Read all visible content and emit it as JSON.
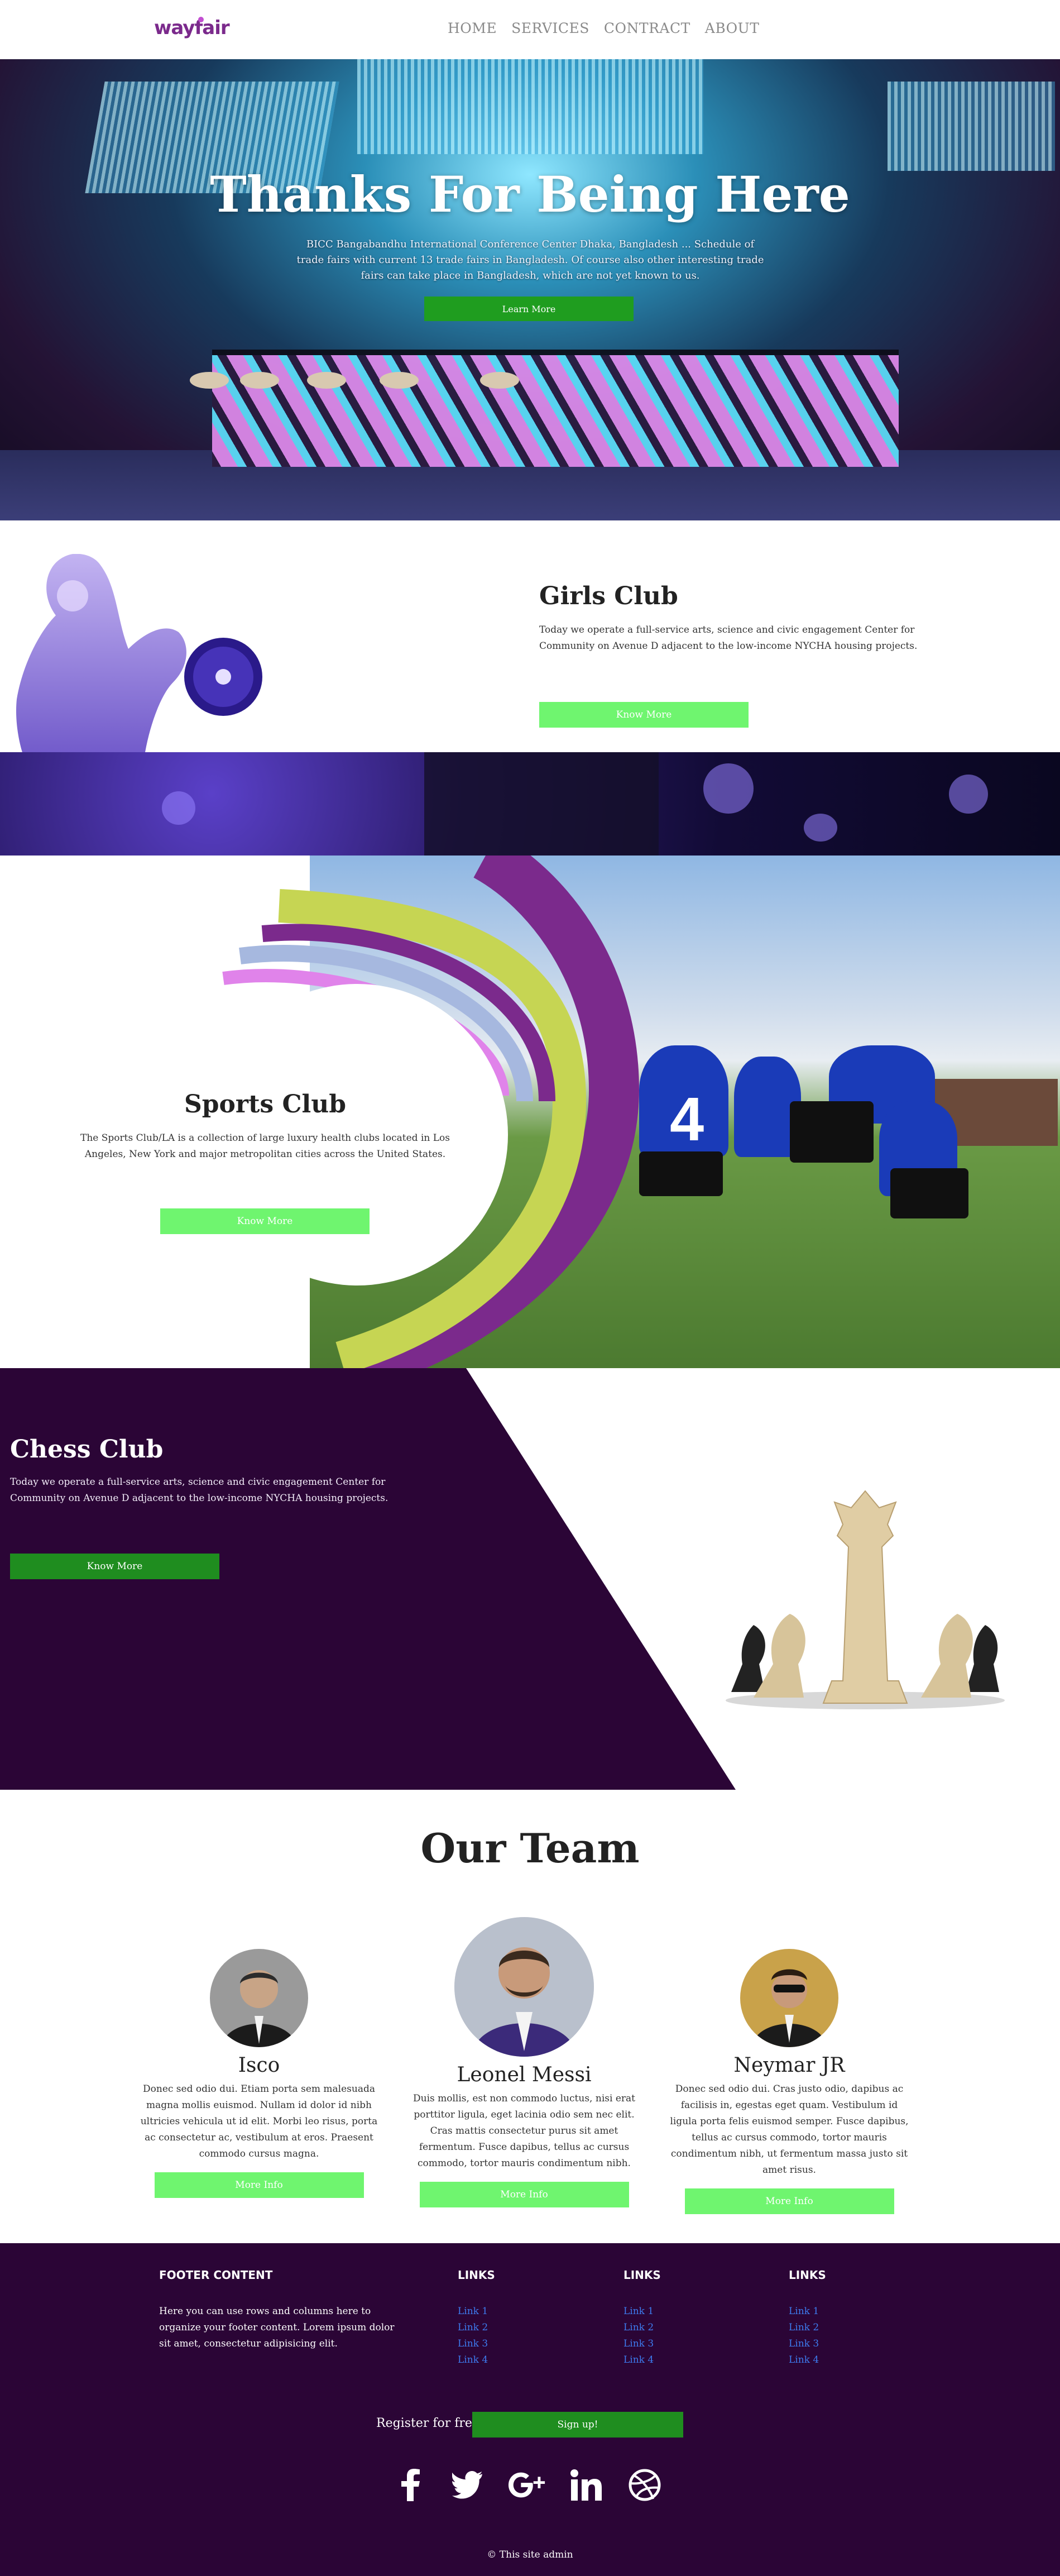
{
  "nav": {
    "logo": "wayfair",
    "links": [
      "HOME",
      "SERVICES",
      "CONTRACT",
      "ABOUT"
    ]
  },
  "hero": {
    "title": "Thanks For Being Here",
    "text": "BICC Bangabandhu International Conference Center Dhaka, Bangladesh ... Schedule of trade fairs with current 13 trade fairs in Bangladesh. Of course also other interesting trade fairs can take place in Bangladesh, which are not yet known to us.",
    "button": "Learn More"
  },
  "girls_club": {
    "title": "Girls Club",
    "text": "Today we operate a full-service arts, science and civic engagement Center for Community on Avenue D adjacent to the low-income NYCHA housing projects.",
    "button": "Know More"
  },
  "sports_club": {
    "title": "Sports Club",
    "text": "The Sports Club/LA is a collection of large luxury health clubs located in Los Angeles, New York and major metropolitan cities across the United States.",
    "button": "Know More",
    "jersey_number": "4"
  },
  "chess_club": {
    "title": "Chess Club",
    "text": "Today we operate a full-service arts, science and civic engagement Center for Community on Avenue D adjacent to the low-income NYCHA housing projects.",
    "button": "Know More"
  },
  "team": {
    "title": "Our Team",
    "members": [
      {
        "name": "Isco",
        "bio": "Donec sed odio dui. Etiam porta sem malesuada magna mollis euismod. Nullam id dolor id nibh ultricies vehicula ut id elit. Morbi leo risus, porta ac consectetur ac, vestibulum at eros. Praesent commodo cursus magna.",
        "button": "More Info"
      },
      {
        "name": "Leonel Messi",
        "bio": "Duis mollis, est non commodo luctus, nisi erat porttitor ligula, eget lacinia odio sem nec elit. Cras mattis consectetur purus sit amet fermentum. Fusce dapibus, tellus ac cursus commodo, tortor mauris condimentum nibh.",
        "button": "More Info"
      },
      {
        "name": "Neymar JR",
        "bio": "Donec sed odio dui. Cras justo odio, dapibus ac facilisis in, egestas eget quam. Vestibulum id ligula porta felis euismod semper. Fusce dapibus, tellus ac cursus commodo, tortor mauris condimentum nibh, ut fermentum massa justo sit amet risus.",
        "button": "More Info"
      }
    ]
  },
  "footer": {
    "content_heading": "FOOTER CONTENT",
    "content_text": "Here you can use rows and columns here to organize your footer content. Lorem ipsum dolor sit amet, consectetur adipisicing elit.",
    "columns": [
      {
        "heading": "LINKS",
        "links": [
          "Link 1",
          "Link 2",
          "Link 3",
          "Link 4"
        ]
      },
      {
        "heading": "LINKS",
        "links": [
          "Link 1",
          "Link 2",
          "Link 3",
          "Link 4"
        ]
      },
      {
        "heading": "LINKS",
        "links": [
          "Link 1",
          "Link 2",
          "Link 3",
          "Link 4"
        ]
      }
    ],
    "register_text": "Register for free",
    "signup_button": "Sign up!",
    "social_icons": [
      "facebook-icon",
      "twitter-icon",
      "google-plus-icon",
      "linkedin-icon",
      "dribbble-icon"
    ],
    "copyright": "© This site admin"
  },
  "colors": {
    "accent_green": "#6ff56f",
    "dark_green": "#1f8d1f",
    "brand_purple": "#7b2a8c",
    "footer_bg": "#2b0536",
    "chess_bg": "#2b0536",
    "link_blue": "#3d7cf0"
  }
}
